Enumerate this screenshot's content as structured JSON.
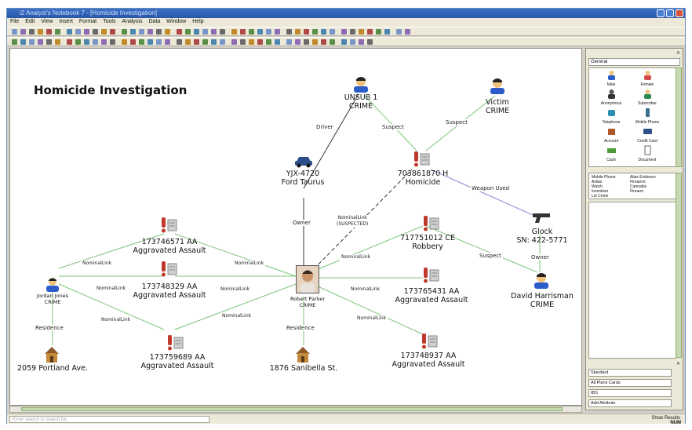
{
  "window": {
    "title": "i2 Analyst's Notebook 7 - [Homicide Investigation]"
  },
  "menu": [
    "File",
    "Edit",
    "View",
    "Insert",
    "Format",
    "Tools",
    "Analysis",
    "Data",
    "Window",
    "Help"
  ],
  "graph": {
    "title": "Homicide Investigation",
    "nodes": {
      "unsub": {
        "line1": "UNSUB 1",
        "line2": "CRIME"
      },
      "victim": {
        "line1": "Victim",
        "line2": "CRIME"
      },
      "car": {
        "line1": "YJX-4720",
        "line2": "Ford Taurus"
      },
      "homicide": {
        "line1": "703861870 H",
        "line2": "Homicide"
      },
      "glock": {
        "line1": "Glock",
        "line2": "SN: 422-5771"
      },
      "assault1": {
        "line1": "173746571 AA",
        "line2": "Aggravated Assault"
      },
      "robbery": {
        "line1": "717751012 CE",
        "line2": "Robbery"
      },
      "jordan": {
        "line1": "Jordan Jones",
        "line2": "CRIME"
      },
      "assault2": {
        "line1": "173748329 AA",
        "line2": "Aggravated Assault"
      },
      "robert": {
        "line1": "Robert Parker",
        "line2": "CRIME"
      },
      "assault3": {
        "line1": "173765431 AA",
        "line2": "Aggravated Assault"
      },
      "david": {
        "line1": "David Harrisman",
        "line2": "CRIME"
      },
      "assault4": {
        "line1": "173759689 AA",
        "line2": "Aggravated Assault"
      },
      "assault5": {
        "line1": "173748937 AA",
        "line2": "Aggravated Assault"
      },
      "house1": {
        "line1": "2059 Portland Ave."
      },
      "house2": {
        "line1": "1876 Sanibella St."
      }
    },
    "edges": {
      "driver": "Driver",
      "suspect1": "Suspect",
      "suspect2": "Suspect",
      "weapon": "Weapon Used",
      "owner1": "Owner",
      "nominal_suspected_1": "NominalLink",
      "nominal_suspected_2": "(SUSPECTED)",
      "suspect3": "Suspect",
      "owner2": "Owner",
      "nl1": "NominalLink",
      "nl2": "NominalLink",
      "nl3": "NominalLink",
      "nl4": "NominalLink",
      "nl5": "NominalLink",
      "nl6": "NominalLink",
      "nl7": "NominalLink",
      "nl8": "NominalLink",
      "nl9": "NominalLink",
      "residence1": "Residence",
      "residence2": "Residence"
    }
  },
  "palette": {
    "header": "General",
    "items": [
      "Male",
      "Female",
      "Anonymous",
      "Subscriber",
      "Telephone",
      "Mobile Phone",
      "Account",
      "Credit Card",
      "Cash",
      "Document"
    ]
  },
  "list": {
    "col1": [
      "Mobile Phone",
      "Aslias",
      "Watch",
      "Investiser",
      "Lst Crime"
    ],
    "col2": [
      "Alias Evidence",
      "Firearms",
      "Cannabis",
      "Firearm"
    ]
  },
  "attributes": {
    "style": "Standard",
    "field1": "All Plans Cards",
    "field2": "IBS",
    "add_button": "Add Attribute"
  },
  "status": {
    "search_placeholder": "Enter search to search for",
    "right_label": "Show Results",
    "num": "NUM"
  },
  "colors": {
    "link_green": "#7dc47a",
    "link_purple": "#9a8fd6",
    "link_dark": "#333333",
    "crime_red": "#c0392b"
  }
}
